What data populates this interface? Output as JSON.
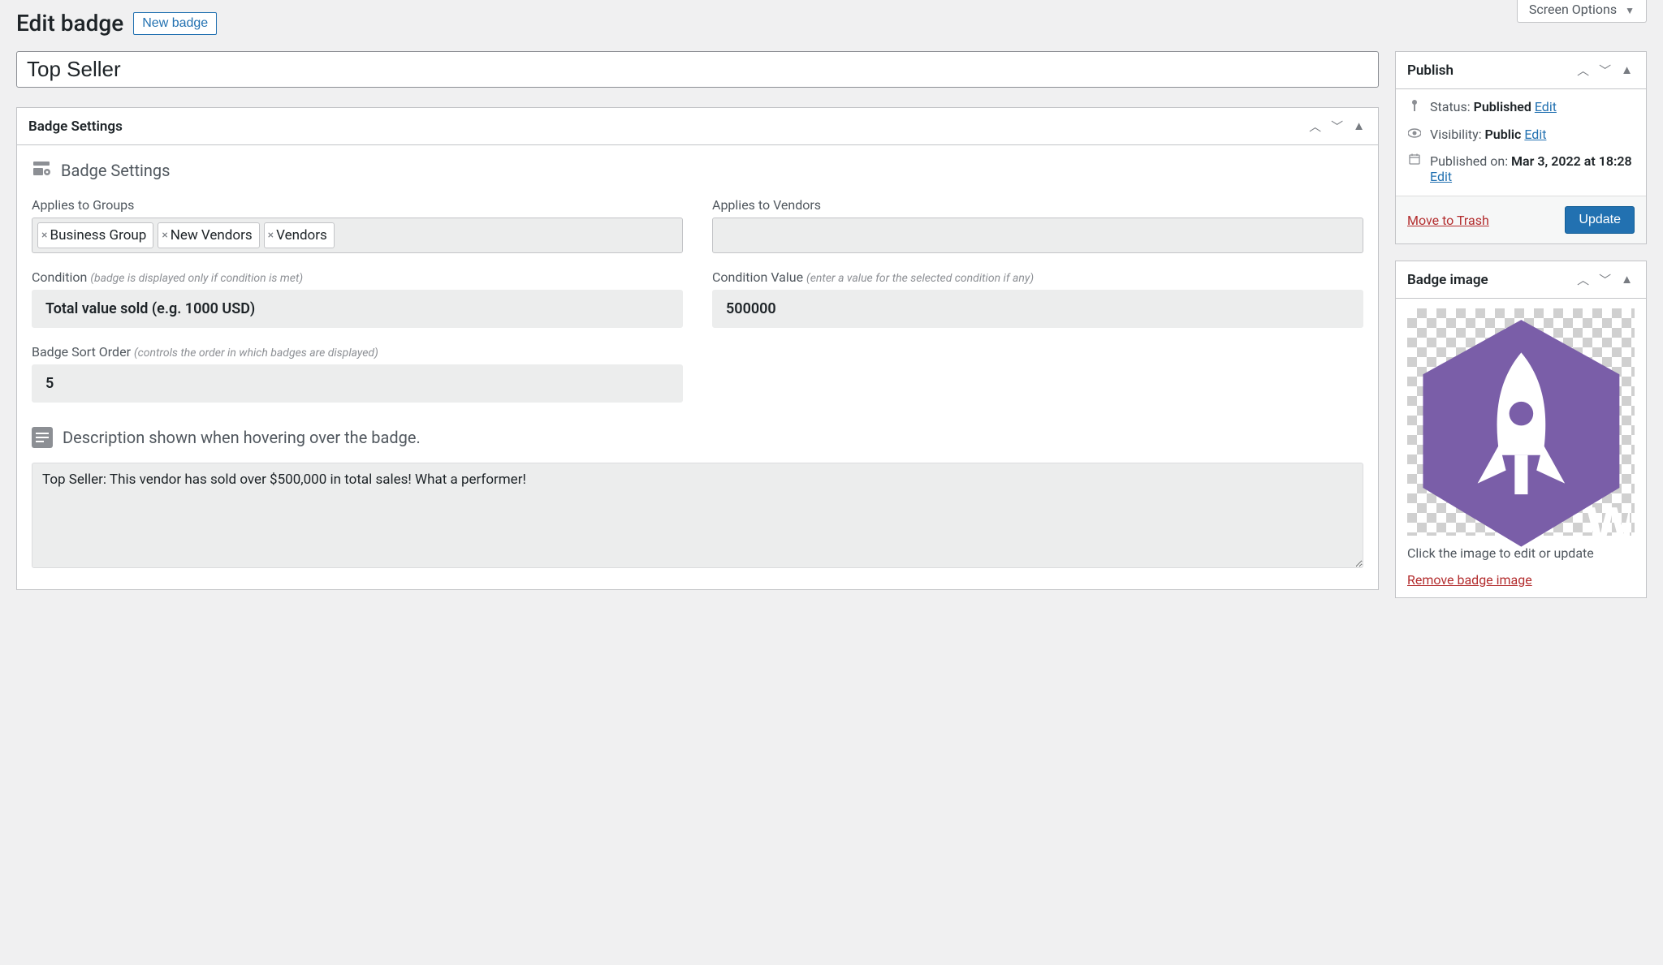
{
  "header": {
    "page_title": "Edit badge",
    "new_badge_button": "New badge",
    "screen_options": "Screen Options"
  },
  "title_field": {
    "value": "Top Seller"
  },
  "badge_settings": {
    "panel_title": "Badge Settings",
    "section_heading": "Badge Settings",
    "applies_to_groups_label": "Applies to Groups",
    "groups": [
      "Business Group",
      "New Vendors",
      "Vendors"
    ],
    "applies_to_vendors_label": "Applies to Vendors",
    "vendors": [],
    "condition_label": "Condition",
    "condition_hint": "(badge is displayed only if condition is met)",
    "condition_value": "Total value sold (e.g. 1000 USD)",
    "condition_value_label": "Condition Value",
    "condition_value_hint": "(enter a value for the selected condition if any)",
    "condition_value_field": "500000",
    "sort_order_label": "Badge Sort Order",
    "sort_order_hint": "(controls the order in which badges are displayed)",
    "sort_order_value": "5",
    "description_heading": "Description shown when hovering over the badge.",
    "description_value": "Top Seller: This vendor has sold over $500,000 in total sales! What a performer!"
  },
  "publish": {
    "panel_title": "Publish",
    "status_label": "Status:",
    "status_value": "Published",
    "status_edit": "Edit",
    "visibility_label": "Visibility:",
    "visibility_value": "Public",
    "visibility_edit": "Edit",
    "published_label": "Published on:",
    "published_value": "Mar 3, 2022 at 18:28",
    "published_edit": "Edit",
    "trash": "Move to Trash",
    "update": "Update"
  },
  "badge_image": {
    "panel_title": "Badge image",
    "caption": "Click the image to edit or update",
    "remove": "Remove badge image",
    "icon_color": "#7a5ea8"
  }
}
